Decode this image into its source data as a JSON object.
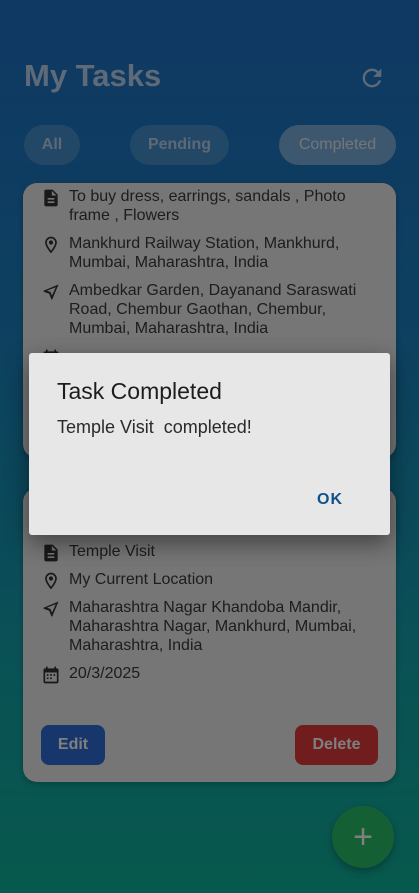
{
  "header": {
    "title": "My Tasks",
    "refresh_icon": "refresh-icon"
  },
  "tabs": [
    {
      "label": "All"
    },
    {
      "label": "Pending"
    },
    {
      "label": "Completed",
      "active": true
    }
  ],
  "tasks": [
    {
      "description": "To buy dress, earrings, sandals , Photo frame , Flowers",
      "from": "Mankhurd Railway Station, Mankhurd, Mumbai, Maharashtra, India",
      "to": "Ambedkar Garden, Dayanand Saraswati Road, Chembur Gaothan, Chembur, Mumbai, Maharashtra, India"
    },
    {
      "description": "Temple Visit",
      "from": "My Current Location",
      "to": "Maharashtra Nagar Khandoba Mandir, Maharashtra Nagar, Mankhurd, Mumbai, Maharashtra, India",
      "date": "20/3/2025",
      "edit_label": "Edit",
      "delete_label": "Delete"
    }
  ],
  "fab": {
    "label": "+"
  },
  "dialog": {
    "title": "Task Completed",
    "message": "Temple Visit  completed!",
    "ok_label": "OK"
  },
  "colors": {
    "edit_button": "#2f6fd8",
    "delete_button": "#e33b3b",
    "fab": "#2bbf6a"
  }
}
